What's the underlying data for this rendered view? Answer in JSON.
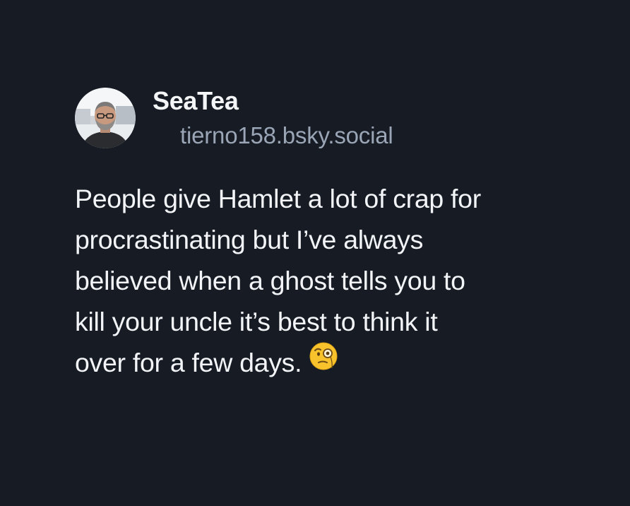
{
  "author": {
    "display_name": "SeaTea",
    "handle": "tierno158.bsky.social",
    "avatar_icon": "profile-photo"
  },
  "post": {
    "lines": [
      "People give Hamlet a lot of crap for",
      "procrastinating but I’ve always",
      "believed when a ghost tells you to",
      "kill your uncle it’s best to think it",
      "over for a few days."
    ],
    "emoji_icon": "face-with-monocle-icon"
  },
  "colors": {
    "background": "#161b24",
    "text": "#f2f4f7",
    "handle": "#9aa5b6"
  }
}
